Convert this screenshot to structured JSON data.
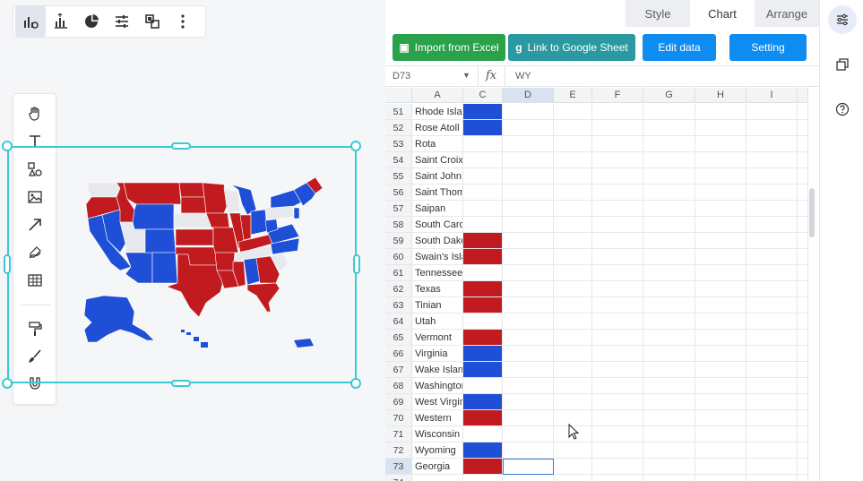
{
  "top_toolbar": {
    "icons": [
      "chart-type-icon",
      "chart-data-icon",
      "pie-chart-icon",
      "sliders-icon",
      "layers-icon",
      "more-icon"
    ]
  },
  "left_tools": {
    "icons": [
      "hand-icon",
      "text-icon",
      "shapes-icon",
      "image-icon",
      "arrow-icon",
      "pen-icon",
      "table-icon",
      "paint-roller-icon",
      "brush-icon",
      "magnet-icon"
    ]
  },
  "panel": {
    "tabs": [
      "Style",
      "Chart",
      "Arrange"
    ],
    "active_tab": "Chart",
    "actions": {
      "import_excel": "Import from Excel",
      "link_google": "Link to Google Sheet",
      "edit_data": "Edit data",
      "setting": "Setting"
    },
    "formula_bar": {
      "cell_ref": "D73",
      "fx": "fx",
      "value": "WY"
    },
    "columns": [
      "A",
      "C",
      "D",
      "E",
      "F",
      "G",
      "H",
      "I"
    ],
    "rows": [
      {
        "n": "51",
        "a": "Rhode Island",
        "c": "blue"
      },
      {
        "n": "52",
        "a": "Rose Atoll",
        "c": "blue"
      },
      {
        "n": "53",
        "a": "Rota",
        "c": ""
      },
      {
        "n": "54",
        "a": "Saint Croix",
        "c": ""
      },
      {
        "n": "55",
        "a": "Saint John",
        "c": ""
      },
      {
        "n": "56",
        "a": "Saint Thomas",
        "c": ""
      },
      {
        "n": "57",
        "a": "Saipan",
        "c": ""
      },
      {
        "n": "58",
        "a": "South Carolina",
        "c": ""
      },
      {
        "n": "59",
        "a": "South Dakota",
        "c": "red"
      },
      {
        "n": "60",
        "a": "Swain's Island",
        "c": "red"
      },
      {
        "n": "61",
        "a": "Tennessee",
        "c": ""
      },
      {
        "n": "62",
        "a": "Texas",
        "c": "red"
      },
      {
        "n": "63",
        "a": "Tinian",
        "c": "red"
      },
      {
        "n": "64",
        "a": "Utah",
        "c": ""
      },
      {
        "n": "65",
        "a": "Vermont",
        "c": "red"
      },
      {
        "n": "66",
        "a": "Virginia",
        "c": "blue"
      },
      {
        "n": "67",
        "a": "Wake Island",
        "c": "blue"
      },
      {
        "n": "68",
        "a": "Washington",
        "c": ""
      },
      {
        "n": "69",
        "a": "West Virginia",
        "c": "blue"
      },
      {
        "n": "70",
        "a": "Western",
        "c": "red"
      },
      {
        "n": "71",
        "a": "Wisconsin",
        "c": ""
      },
      {
        "n": "72",
        "a": "Wyoming",
        "c": "blue"
      },
      {
        "n": "73",
        "a": "Georgia",
        "c": "red"
      },
      {
        "n": "74",
        "a": "",
        "c": ""
      }
    ],
    "selected_row": "73"
  },
  "colors": {
    "red": "#c11b1f",
    "blue": "#1e4fd6",
    "grey": "#e8e9ec",
    "accent": "#3cc9d3"
  },
  "rail": {
    "icons": [
      "settings-sliders-icon",
      "copy-icon",
      "help-icon"
    ]
  }
}
